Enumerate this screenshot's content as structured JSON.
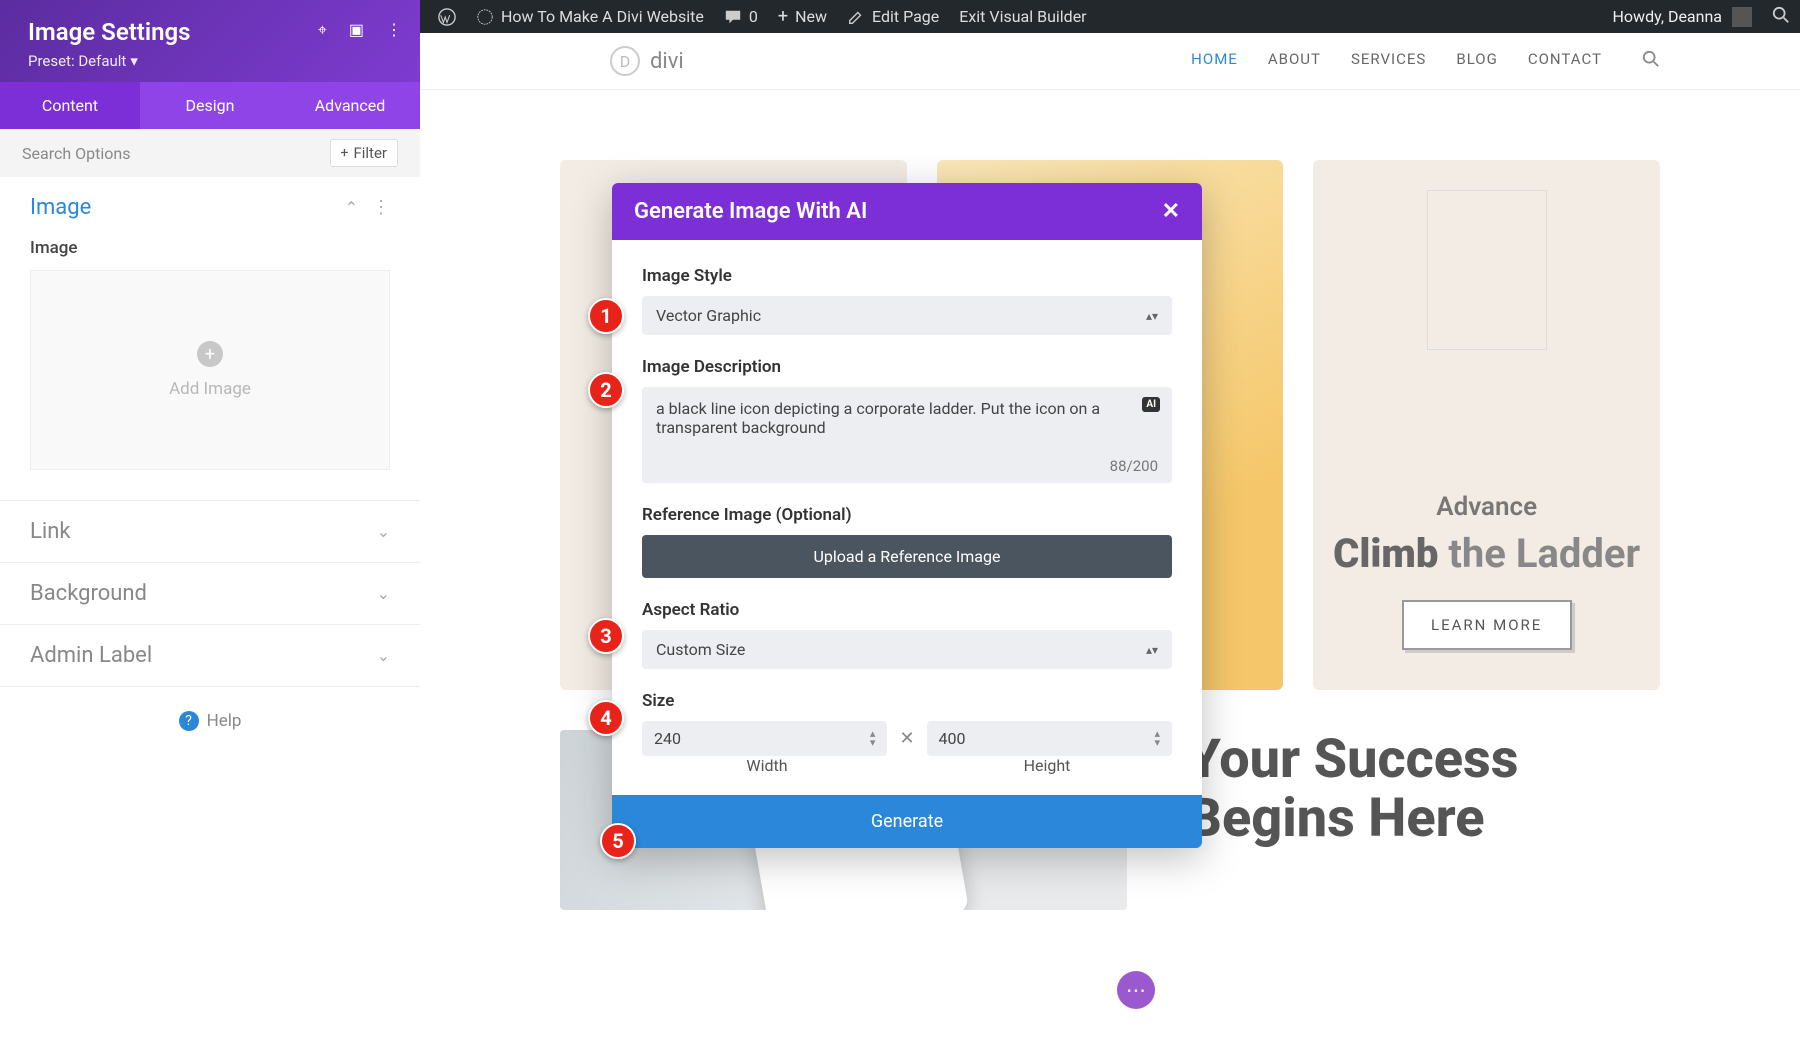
{
  "wp_bar": {
    "site_title": "How To Make A Divi Website",
    "comments": "0",
    "new": "New",
    "edit": "Edit Page",
    "exit": "Exit Visual Builder",
    "greeting": "Howdy, Deanna"
  },
  "sidebar": {
    "title": "Image Settings",
    "preset": "Preset: Default",
    "tabs": {
      "content": "Content",
      "design": "Design",
      "advanced": "Advanced"
    },
    "search_placeholder": "Search Options",
    "filter": "Filter",
    "image_section": "Image",
    "image_label": "Image",
    "add_image": "Add Image",
    "link": "Link",
    "background": "Background",
    "admin_label": "Admin Label",
    "help": "Help"
  },
  "site": {
    "logo": "divi",
    "nav": {
      "home": "HOME",
      "about": "ABOUT",
      "services": "SERVICES",
      "blog": "BLOG",
      "contact": "CONTACT"
    },
    "card3": {
      "t1": "Advance",
      "t2a": "Climb",
      "t2b": "the Ladder",
      "btn": "LEARN MORE"
    },
    "hero": "Your Success Begins Here"
  },
  "modal": {
    "title": "Generate Image With AI",
    "style_label": "Image Style",
    "style_value": "Vector Graphic",
    "desc_label": "Image Description",
    "desc_value": "a black line icon depicting a corporate ladder. Put the icon on a transparent background",
    "desc_count": "88/200",
    "ref_label": "Reference Image (Optional)",
    "upload": "Upload a Reference Image",
    "aspect_label": "Aspect Ratio",
    "aspect_value": "Custom Size",
    "size_label": "Size",
    "width": "240",
    "height": "400",
    "width_lbl": "Width",
    "height_lbl": "Height",
    "generate": "Generate"
  },
  "callouts": [
    "1",
    "2",
    "3",
    "4",
    "5"
  ]
}
